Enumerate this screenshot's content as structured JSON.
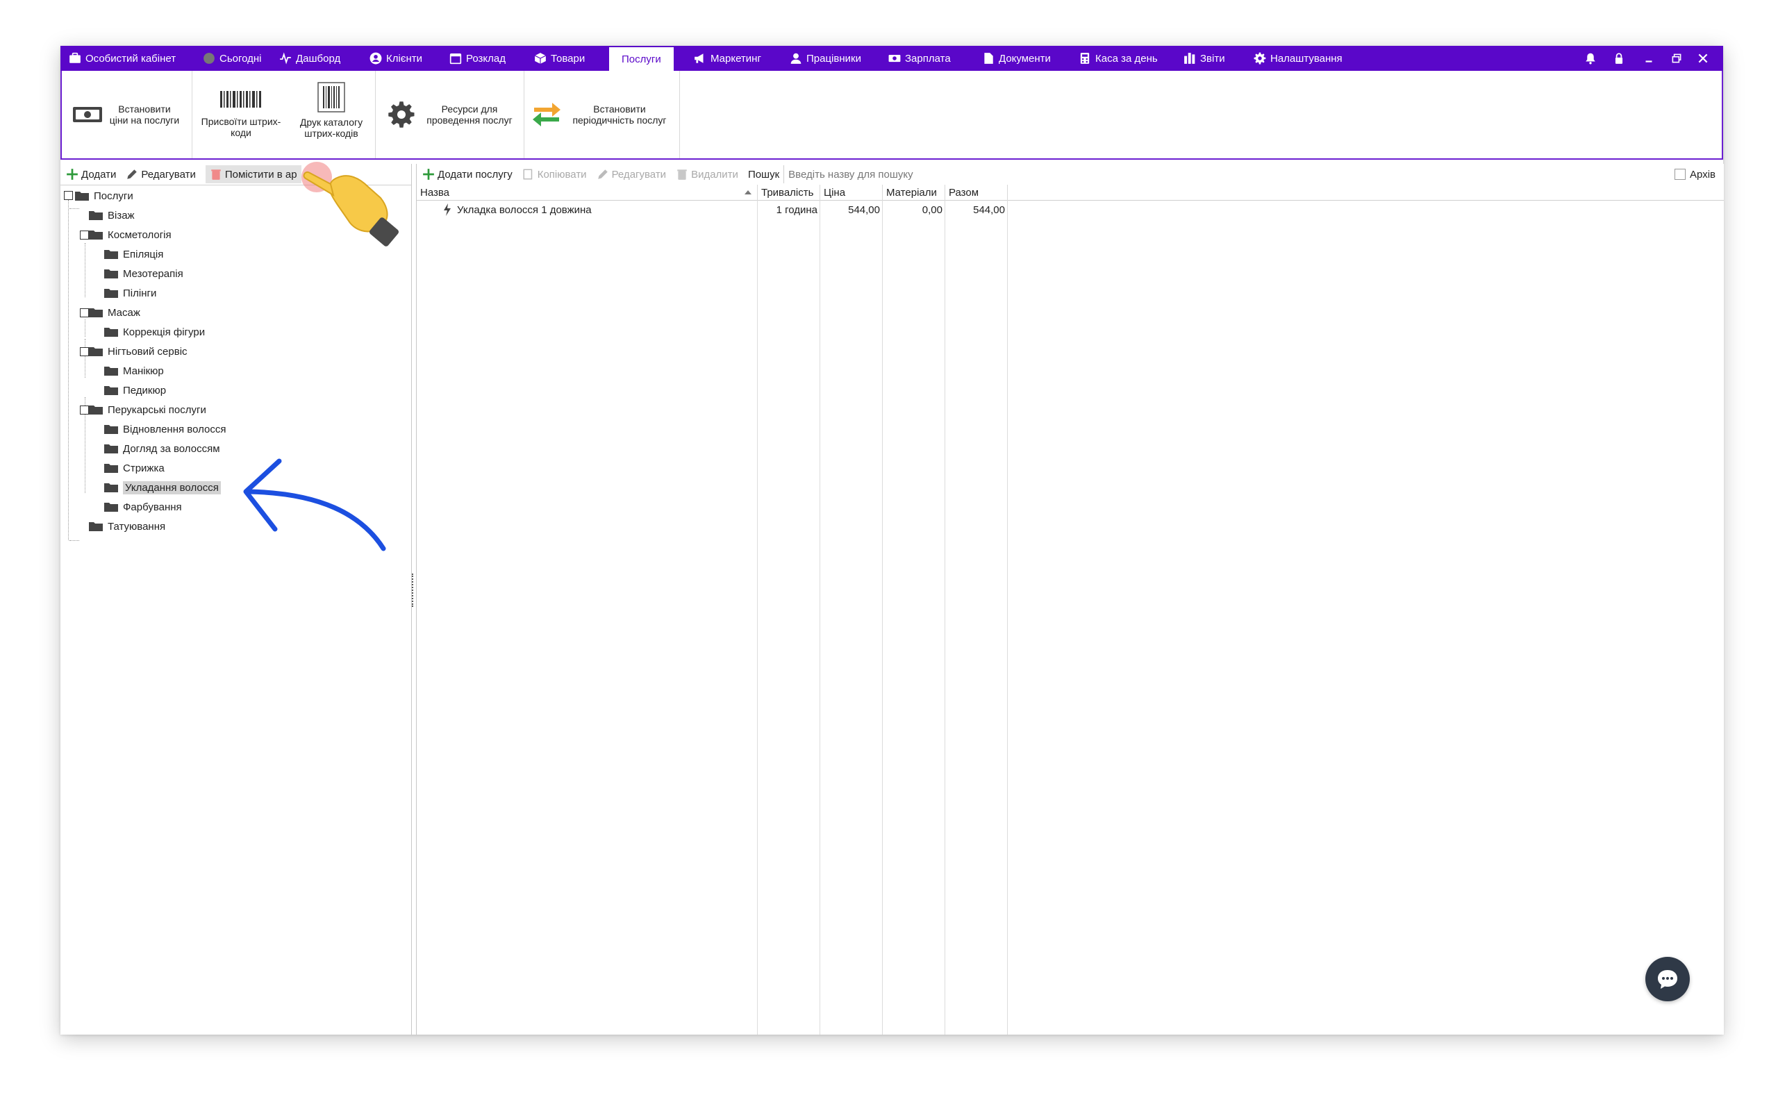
{
  "nav": {
    "tabs": [
      {
        "label": "Особистий кабінет",
        "icon": "briefcase-icon"
      },
      {
        "label": "Сьогодні",
        "icon": "circle-icon"
      },
      {
        "label": "Дашборд",
        "icon": "pulse-icon"
      },
      {
        "label": "Клієнти",
        "icon": "user-circle-icon"
      },
      {
        "label": "Розклад",
        "icon": "calendar-icon"
      },
      {
        "label": "Товари",
        "icon": "box-icon"
      },
      {
        "label": "Послуги",
        "icon": "",
        "active": true
      },
      {
        "label": "Маркетинг",
        "icon": "megaphone-icon"
      },
      {
        "label": "Працівники",
        "icon": "user-icon"
      },
      {
        "label": "Зарплата",
        "icon": "money-icon"
      },
      {
        "label": "Документи",
        "icon": "document-icon"
      },
      {
        "label": "Каса за день",
        "icon": "calculator-icon"
      },
      {
        "label": "Звіти",
        "icon": "bar-chart-icon"
      },
      {
        "label": "Налаштування",
        "icon": "gear-icon"
      }
    ],
    "window_controls": [
      "bell-icon",
      "lock-icon",
      "minimize-icon",
      "restore-icon",
      "close-icon"
    ]
  },
  "ribbon": {
    "set_prices": "Встановити ціни на послуги",
    "assign_barcodes": "Присвоїти штрих-коди",
    "print_catalog": "Друк каталогу штрих-кодів",
    "resources": "Ресурси для проведення послуг",
    "periodicity": "Встановити періодичність послуг"
  },
  "left_toolbar": {
    "add": "Додати",
    "edit": "Редагувати",
    "archive": "Помістити в ар"
  },
  "tree": {
    "root": "Послуги",
    "vizazh": "Візаж",
    "kosmetologiya": "Косметологія",
    "epilyatsiya": "Епіляція",
    "mezoterapiya": "Мезотерапія",
    "pilingy": "Пілінги",
    "masazh": "Масаж",
    "korrektsiya": "Коррекція фігури",
    "nigtovyi": "Нігтьовий сервіс",
    "manikyur": "Манікюр",
    "pedykyur": "Педикюр",
    "perukarski": "Перукарські послуги",
    "vidnovlennya": "Відновлення волосся",
    "doglyad": "Догляд за волоссям",
    "stryzhka": "Стрижка",
    "ukladannya": "Укладання волосся",
    "farbuvannya": "Фарбування",
    "tatuyuvannya": "Татуювання"
  },
  "right_toolbar": {
    "add_service": "Додати послугу",
    "copy": "Копіювати",
    "edit": "Редагувати",
    "delete": "Видалити",
    "search_label": "Пошук",
    "search_placeholder": "Введіть назву для пошуку",
    "archive_label": "Архів"
  },
  "grid": {
    "headers": {
      "name": "Назва",
      "duration": "Тривалість",
      "price": "Ціна",
      "materials": "Матеріали",
      "total": "Разом"
    },
    "rows": [
      {
        "name": "Укладка волосся 1 довжина",
        "duration": "1 година",
        "price": "544,00",
        "materials": "0,00",
        "total": "544,00"
      }
    ]
  },
  "colors": {
    "nav_bg": "#5a07c9",
    "annotation_arrow": "#1c4fe0",
    "chat_button": "#2f3947"
  }
}
